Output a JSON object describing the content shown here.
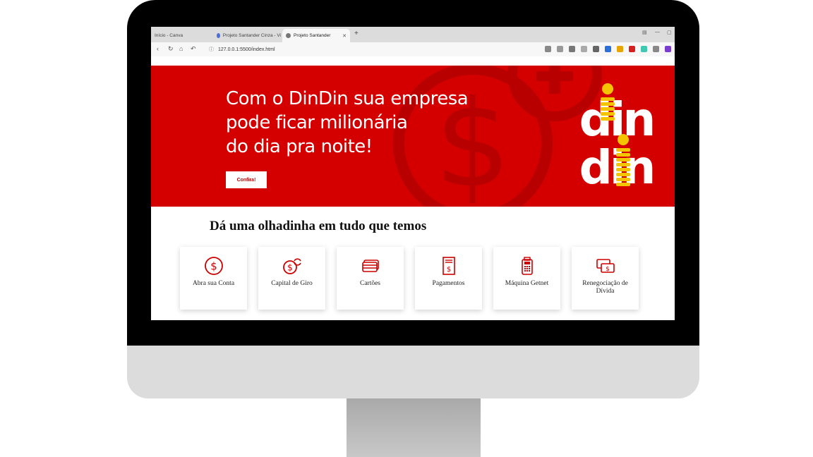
{
  "browser": {
    "tabs": [
      {
        "label": "Início - Canva",
        "active": false
      },
      {
        "label": "Projeto Santander Cinza - Vi",
        "active": false
      },
      {
        "label": "Projeto Santander",
        "active": true
      }
    ],
    "new_tab": "+",
    "url": "127.0.0.1:5500/index.html"
  },
  "hero": {
    "headline_line1": "Com o DinDin sua empresa",
    "headline_line2": "pode ficar milionária",
    "headline_line3": "do dia pra noite!",
    "cta_label": "Confira!",
    "logo_top": "din",
    "logo_bottom": "din"
  },
  "services": {
    "title": "Dá uma olhadinha em tudo que temos",
    "items": [
      {
        "label": "Abra sua Conta",
        "icon": "dollar-circle-icon"
      },
      {
        "label": "Capital de Giro",
        "icon": "dollar-refresh-icon"
      },
      {
        "label": "Cartões",
        "icon": "cards-icon"
      },
      {
        "label": "Pagamentos",
        "icon": "receipt-icon"
      },
      {
        "label": "Máquina Getnet",
        "icon": "card-machine-icon"
      },
      {
        "label": "Renegociação de Dívida",
        "icon": "money-exchange-icon"
      }
    ]
  },
  "colors": {
    "brand_red": "#d40000",
    "icon_red": "#cc0000",
    "coin_yellow": "#f5c400"
  }
}
